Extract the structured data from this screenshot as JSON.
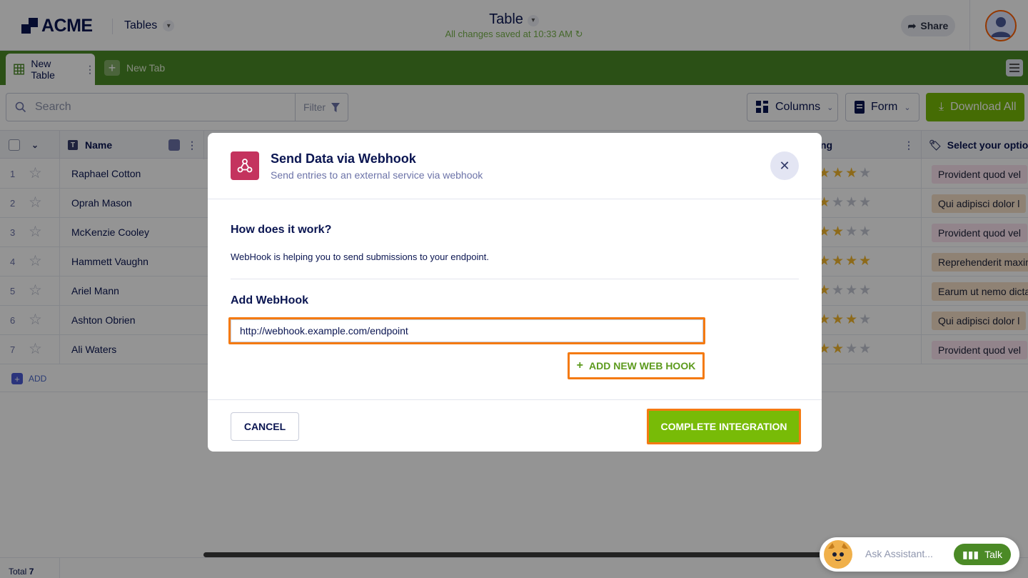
{
  "header": {
    "brand": "ACME",
    "tables_menu": "Tables",
    "title": "Table",
    "save_status": "All changes saved at 10:33 AM",
    "share": "Share"
  },
  "tabs": {
    "active": "New Table",
    "new_tab": "New Tab"
  },
  "toolbar": {
    "search_placeholder": "Search",
    "filter": "Filter",
    "columns": "Columns",
    "form": "Form",
    "download_all": "Download All"
  },
  "grid": {
    "columns": {
      "name": "Name",
      "rating": "ng",
      "select": "Select your option"
    },
    "rows": [
      {
        "num": "1",
        "name": "Raphael Cotton",
        "stars": 3,
        "tag": "Provident quod vel",
        "tag_color": "#fbe3f0"
      },
      {
        "num": "2",
        "name": "Oprah Mason",
        "stars": 1,
        "tag": "Qui adipisci dolor l",
        "tag_color": "#f7e1c8"
      },
      {
        "num": "3",
        "name": "McKenzie Cooley",
        "stars": 2,
        "tag": "Provident quod vel",
        "tag_color": "#fbe3f0"
      },
      {
        "num": "4",
        "name": "Hammett Vaughn",
        "stars": 4,
        "tag": "Reprehenderit maxim",
        "tag_color": "#f7e1c8"
      },
      {
        "num": "5",
        "name": "Ariel Mann",
        "stars": 1,
        "tag": "Earum ut nemo dicta",
        "tag_color": "#f7e1c8"
      },
      {
        "num": "6",
        "name": "Ashton Obrien",
        "stars": 3,
        "tag": "Qui adipisci dolor l",
        "tag_color": "#f7e1c8"
      },
      {
        "num": "7",
        "name": "Ali Waters",
        "stars": 2,
        "tag": "Provident quod vel",
        "tag_color": "#fbe3f0"
      }
    ],
    "add_label": "ADD",
    "total_label": "Total",
    "total_value": "7"
  },
  "modal": {
    "title": "Send Data via Webhook",
    "subtitle": "Send entries to an external service via webhook",
    "how_title": "How does it work?",
    "how_desc": "WebHook is helping you to send submissions to your endpoint.",
    "add_title": "Add WebHook",
    "webhook_url": "http://webhook.example.com/endpoint",
    "add_new_hook": "ADD NEW WEB HOOK",
    "cancel": "CANCEL",
    "complete": "COMPLETE INTEGRATION"
  },
  "assistant": {
    "placeholder": "Ask Assistant...",
    "talk": "Talk"
  },
  "colors": {
    "brand_navy": "#0a1551",
    "tab_green": "#4b8a26",
    "action_green": "#78bb07",
    "highlight_orange": "#f47a12",
    "webhook_icon": "#c4335e"
  }
}
